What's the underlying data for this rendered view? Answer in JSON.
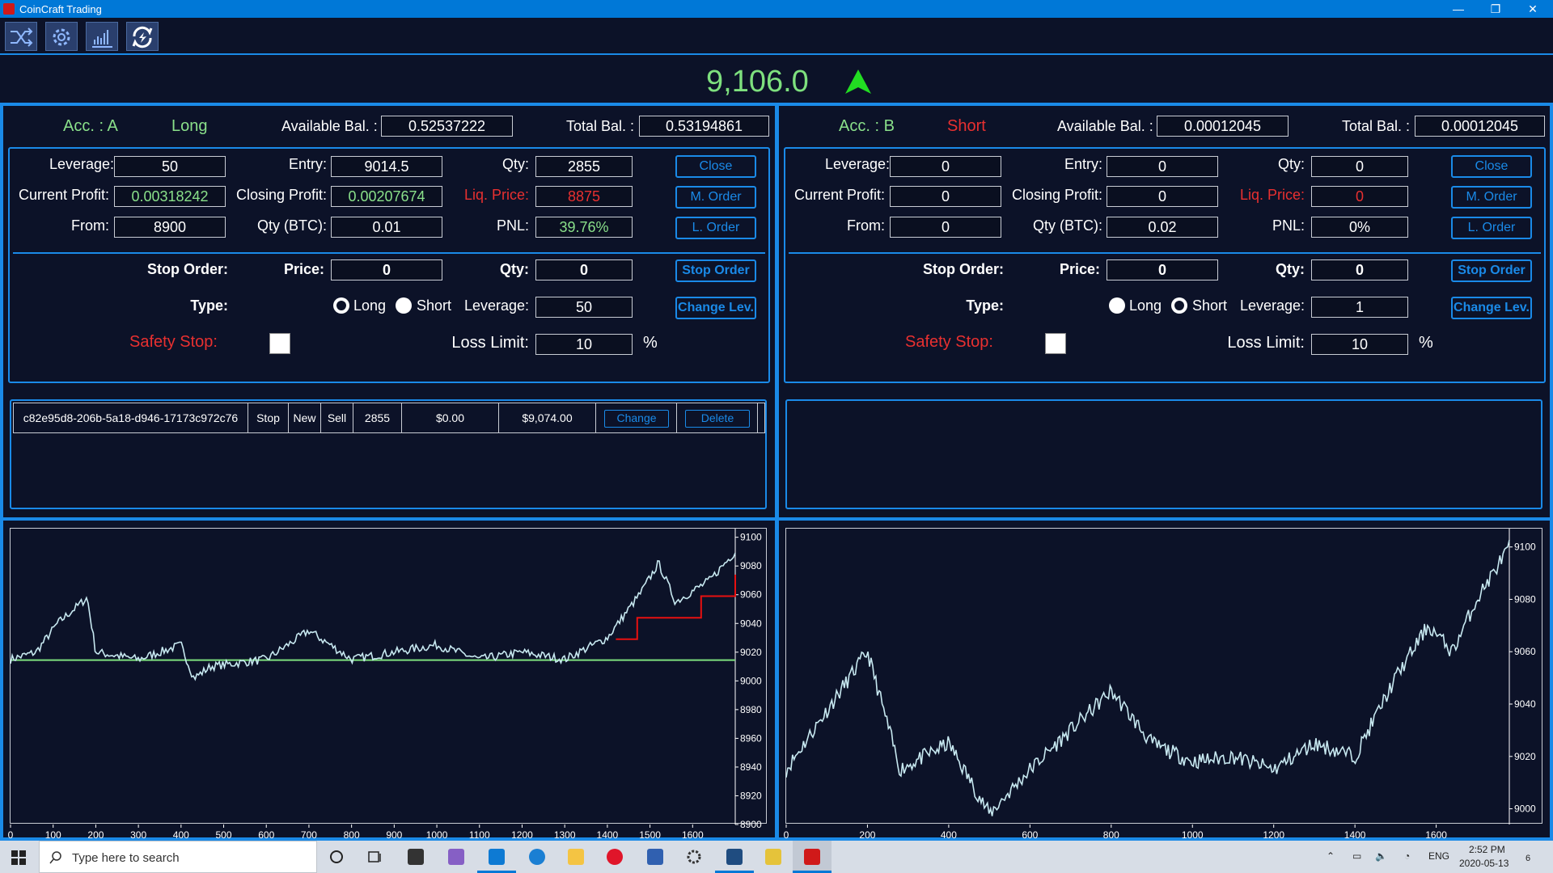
{
  "window": {
    "title": "CoinCraft Trading",
    "minimize": "—",
    "restore": "❐",
    "close": "✕"
  },
  "toolbar": {
    "icons": [
      "shuffle-icon",
      "gear-icon",
      "chart-icon",
      "sync-icon"
    ]
  },
  "price": {
    "value": "9,106.0",
    "direction": "up"
  },
  "accounts": [
    {
      "name": "Acc. : A",
      "side": "Long",
      "side_color": "#8ae08a",
      "available_label": "Available Bal. :",
      "available": "0.52537222",
      "total_label": "Total Bal. :",
      "total": "0.53194861",
      "leverage_label": "Leverage:",
      "leverage": "50",
      "entry_label": "Entry:",
      "entry": "9014.5",
      "qty_label": "Qty:",
      "qty": "2855",
      "current_profit_label": "Current Profit:",
      "current_profit": "0.00318242",
      "closing_profit_label": "Closing Profit:",
      "closing_profit": "0.00207674",
      "liq_label": "Liq. Price:",
      "liq": "8875",
      "from_label": "From:",
      "from": "8900",
      "qty_btc_label": "Qty (BTC):",
      "qty_btc": "0.01",
      "pnl_label": "PNL:",
      "pnl": "39.76%",
      "btn_close": "Close",
      "btn_morder": "M. Order",
      "btn_lorder": "L. Order",
      "stop_order_label": "Stop Order:",
      "price_label": "Price:",
      "stop_price": "0",
      "stop_qty_label": "Qty:",
      "stop_qty": "0",
      "btn_stop": "Stop Order",
      "type_label": "Type:",
      "long_label": "Long",
      "short_label": "Short",
      "type_selected": "long",
      "stop_lev_label": "Leverage:",
      "stop_lev": "50",
      "btn_change_lev": "Change Lev.",
      "safety_label": "Safety Stop:",
      "loss_limit_label": "Loss Limit:",
      "loss_limit": "10",
      "pct": "%",
      "orders": [
        {
          "id": "c82e95d8-206b-5a18-d946-17173c972c76",
          "type": "Stop",
          "status": "New",
          "side": "Sell",
          "qty": "2855",
          "amount": "$0.00",
          "price": "$9,074.00",
          "change": "Change",
          "delete": "Delete"
        }
      ],
      "chart": {
        "x_ticks": [
          "0",
          "100",
          "200",
          "300",
          "400",
          "500",
          "600",
          "700",
          "800",
          "900",
          "1000",
          "1100",
          "1200",
          "1300",
          "1400",
          "1500",
          "1600"
        ],
        "y_ticks": [
          "9100",
          "9080",
          "9060",
          "9040",
          "9020",
          "9000",
          "8980",
          "8960",
          "8940",
          "8920",
          "8900"
        ],
        "xlim": [
          0,
          1700
        ],
        "ylim": [
          8900,
          9106
        ],
        "reference_line": 9014.5,
        "stop_steps": [
          [
            1420,
            9029
          ],
          [
            1470,
            9029
          ],
          [
            1470,
            9044
          ],
          [
            1620,
            9044
          ],
          [
            1620,
            9059
          ],
          [
            1700,
            9059
          ],
          [
            1700,
            9074
          ]
        ]
      }
    },
    {
      "name": "Acc. : B",
      "side": "Short",
      "side_color": "#e83030",
      "available_label": "Available Bal. :",
      "available": "0.00012045",
      "total_label": "Total Bal. :",
      "total": "0.00012045",
      "leverage_label": "Leverage:",
      "leverage": "0",
      "entry_label": "Entry:",
      "entry": "0",
      "qty_label": "Qty:",
      "qty": "0",
      "current_profit_label": "Current Profit:",
      "current_profit": "0",
      "closing_profit_label": "Closing Profit:",
      "closing_profit": "0",
      "liq_label": "Liq. Price:",
      "liq": "0",
      "from_label": "From:",
      "from": "0",
      "qty_btc_label": "Qty (BTC):",
      "qty_btc": "0.02",
      "pnl_label": "PNL:",
      "pnl": "0%",
      "btn_close": "Close",
      "btn_morder": "M. Order",
      "btn_lorder": "L. Order",
      "stop_order_label": "Stop Order:",
      "price_label": "Price:",
      "stop_price": "0",
      "stop_qty_label": "Qty:",
      "stop_qty": "0",
      "btn_stop": "Stop Order",
      "type_label": "Type:",
      "long_label": "Long",
      "short_label": "Short",
      "type_selected": "short",
      "stop_lev_label": "Leverage:",
      "stop_lev": "1",
      "btn_change_lev": "Change Lev.",
      "safety_label": "Safety Stop:",
      "loss_limit_label": "Loss Limit:",
      "loss_limit": "10",
      "pct": "%",
      "orders": [],
      "chart": {
        "x_ticks": [
          "0",
          "200",
          "400",
          "600",
          "800",
          "1000",
          "1200",
          "1400",
          "1600"
        ],
        "y_ticks": [
          "9100",
          "9080",
          "9060",
          "9040",
          "9020",
          "9000"
        ],
        "xlim": [
          0,
          1780
        ],
        "ylim": [
          8994,
          9107
        ]
      }
    }
  ],
  "taskbar": {
    "search_placeholder": "Type here to search",
    "lang": "ENG",
    "time": "2:52 PM",
    "date": "2020-05-13",
    "notifications": "6"
  }
}
